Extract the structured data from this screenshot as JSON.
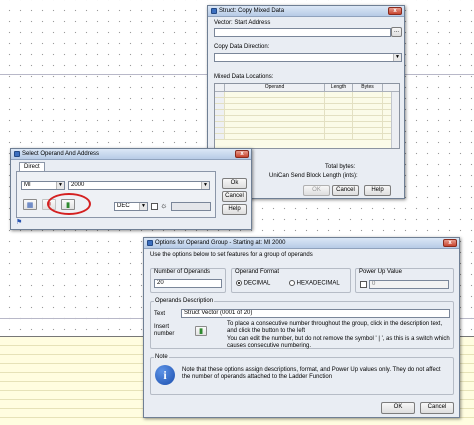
{
  "struct_dialog": {
    "title": "Struct: Copy Mixed Data",
    "close": "x",
    "vector_label": "Vector: Start Address",
    "browse": "...",
    "direction_label": "Copy Data Direction:",
    "mixed_label": "Mixed Data Locations:",
    "columns": [
      "Operand",
      "Length",
      "Bytes"
    ],
    "total_label": "Total bytes:",
    "unican_label": "UniCan Send Block Length (ints):",
    "ok": "OK",
    "cancel": "Cancel",
    "help": "Help"
  },
  "select_dialog": {
    "title": "Select Operand And Address",
    "close": "x",
    "tab": "Direct",
    "operand": "MI",
    "address": "2000",
    "format": "DEC",
    "ok": "Ok",
    "cancel": "Cancel",
    "help": "Help"
  },
  "options_dialog": {
    "title": "Options for Operand Group - Starting at: MI 2000",
    "close": "x",
    "intro": "Use the options below to set features for a group of operands",
    "num_label": "Number of Operands",
    "num_value": "20",
    "format_label": "Operand Format",
    "decimal": "DECIMAL",
    "hex": "HEXADECIMAL",
    "powerup_label": "Power Up Value",
    "powerup_value": "0",
    "desc_group": "Operands Description",
    "text_label": "Text",
    "text_value": "Struct Vector (0001 of 20)",
    "insert_label": "Insert number",
    "hint1": "To place a consecutive number throughout the group, click in the description text, and click the button to the left",
    "hint2": "You can edit the number, but do not remove the symbol ' | ', as this is a switch which causes consecutive numbering.",
    "note_group": "Note",
    "note_text": "Note that these options assign descriptions, format, and Power Up values only. They do not affect the number of operands attached to the Ladder Function",
    "ok": "OK",
    "cancel": "Cancel"
  },
  "colors": {
    "highlight": "#d42020",
    "dialog_bg": "#e9edf3"
  }
}
